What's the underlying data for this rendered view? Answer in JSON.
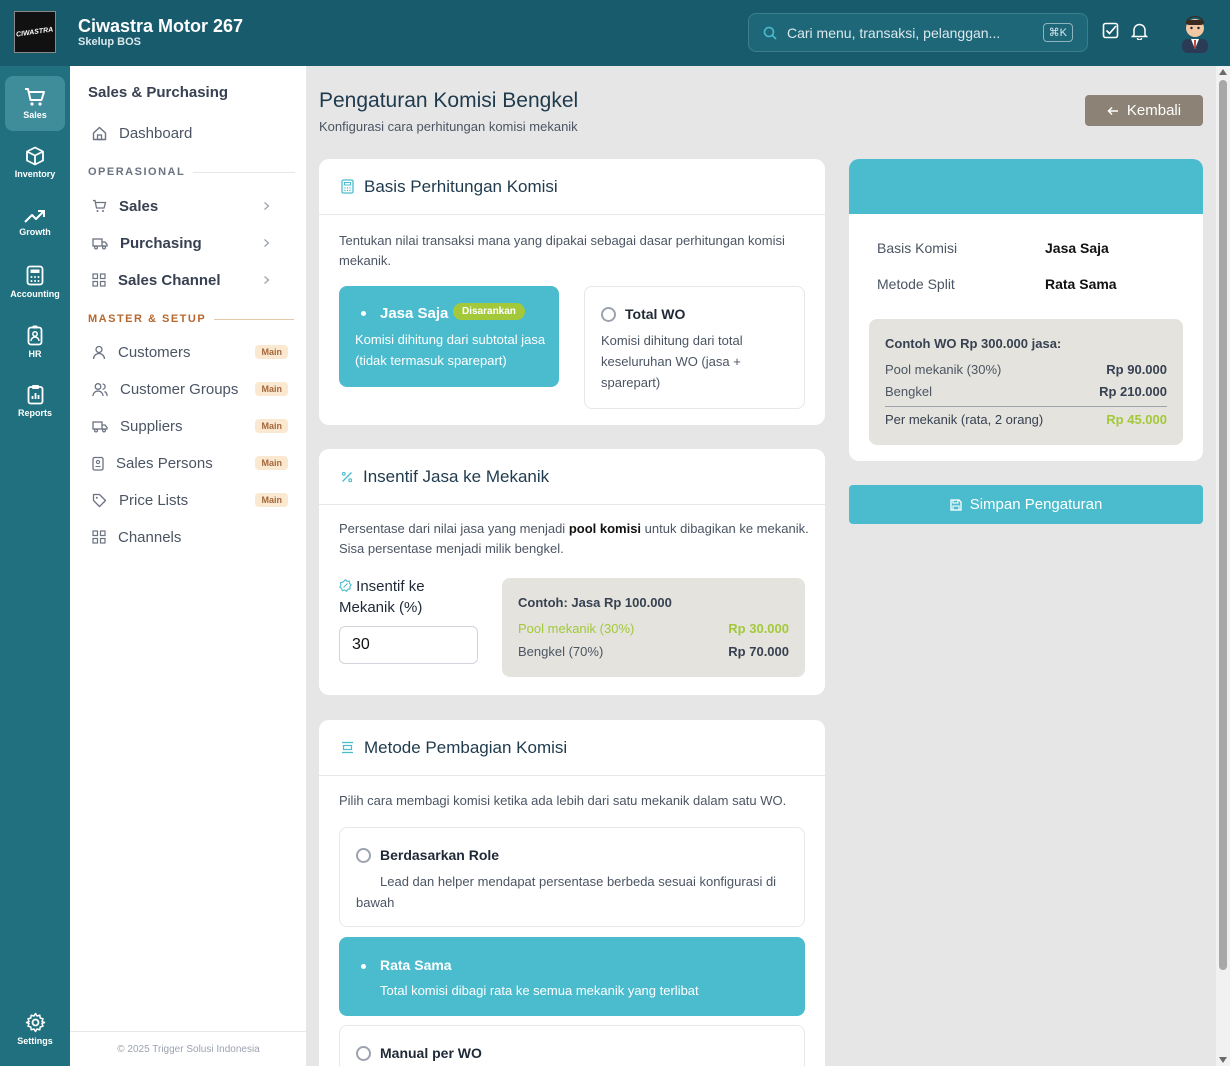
{
  "header": {
    "logo_text": "CIWASTRA",
    "title": "Ciwastra Motor 267",
    "subtitle": "Skelup BOS",
    "search_placeholder": "Cari menu, transaksi, pelanggan...",
    "search_shortcut": "⌘K"
  },
  "rail": {
    "items": [
      {
        "label": "Sales",
        "icon": "cart-icon",
        "active": true
      },
      {
        "label": "Inventory",
        "icon": "box-icon"
      },
      {
        "label": "Growth",
        "icon": "trending-up-icon"
      },
      {
        "label": "Accounting",
        "icon": "calculator-icon"
      },
      {
        "label": "HR",
        "icon": "id-badge-icon"
      },
      {
        "label": "Reports",
        "icon": "clipboard-icon"
      }
    ],
    "settings_label": "Settings"
  },
  "sidebar": {
    "title": "Sales & Purchasing",
    "dashboard": "Dashboard",
    "section_operasional": "OPERASIONAL",
    "operasional": [
      "Sales",
      "Purchasing",
      "Sales Channel"
    ],
    "section_master": "MASTER & SETUP",
    "master": [
      {
        "label": "Customers",
        "badge": "Main"
      },
      {
        "label": "Customer Groups",
        "badge": "Main"
      },
      {
        "label": "Suppliers",
        "badge": "Main"
      },
      {
        "label": "Sales Persons",
        "badge": "Main"
      },
      {
        "label": "Price Lists",
        "badge": "Main"
      },
      {
        "label": "Channels",
        "badge": ""
      }
    ],
    "footer": "© 2025 Trigger Solusi Indonesia"
  },
  "page": {
    "title": "Pengaturan Komisi Bengkel",
    "subtitle": "Konfigurasi cara perhitungan komisi mekanik",
    "back_label": "Kembali"
  },
  "basis": {
    "heading": "Basis Perhitungan Komisi",
    "desc": "Tentukan nilai transaksi mana yang dipakai sebagai dasar perhitungan komisi mekanik.",
    "opt1_title": "Jasa Saja",
    "opt1_badge": "Disarankan",
    "opt1_desc": "Komisi dihitung dari subtotal jasa (tidak termasuk sparepart)",
    "opt2_title": "Total WO",
    "opt2_desc": "Komisi dihitung dari total keseluruhan WO (jasa + sparepart)"
  },
  "insentif": {
    "heading": "Insentif Jasa ke Mekanik",
    "desc_pre": "Persentase dari nilai jasa yang menjadi ",
    "desc_bold": "pool komisi",
    "desc_post": " untuk dibagikan ke mekanik. Sisa persentase menjadi milik bengkel.",
    "field_label": "Insentif ke Mekanik (%)",
    "field_value": "30",
    "ex_title": "Contoh: Jasa Rp 100.000",
    "ex_pool_label": "Pool mekanik (30%)",
    "ex_pool_value": "Rp 30.000",
    "ex_bengkel_label": "Bengkel (70%)",
    "ex_bengkel_value": "Rp 70.000"
  },
  "metode": {
    "heading": "Metode Pembagian Komisi",
    "desc": "Pilih cara membagi komisi ketika ada lebih dari satu mekanik dalam satu WO.",
    "opt1_title": "Berdasarkan Role",
    "opt1_desc": "Lead dan helper mendapat persentase berbeda sesuai konfigurasi di bawah",
    "opt2_title": "Rata Sama",
    "opt2_desc": "Total komisi dibagi rata ke semua mekanik yang terlibat",
    "opt3_title": "Manual per WO"
  },
  "summary": {
    "basis_label": "Basis Komisi",
    "basis_value": "Jasa Saja",
    "metode_label": "Metode Split",
    "metode_value": "Rata Sama",
    "ex_title": "Contoh WO Rp 300.000 jasa:",
    "pool_label": "Pool mekanik (30%)",
    "pool_value": "Rp 90.000",
    "bengkel_label": "Bengkel",
    "bengkel_value": "Rp 210.000",
    "per_label": "Per mekanik (rata, 2 orang)",
    "per_value": "Rp 45.000",
    "save_label": "Simpan Pengaturan"
  },
  "colors": {
    "topbar": "#175b6c",
    "rail": "#20707f",
    "accent": "#4bbcce",
    "green": "#a3c93a",
    "back_button": "#8c8275"
  }
}
